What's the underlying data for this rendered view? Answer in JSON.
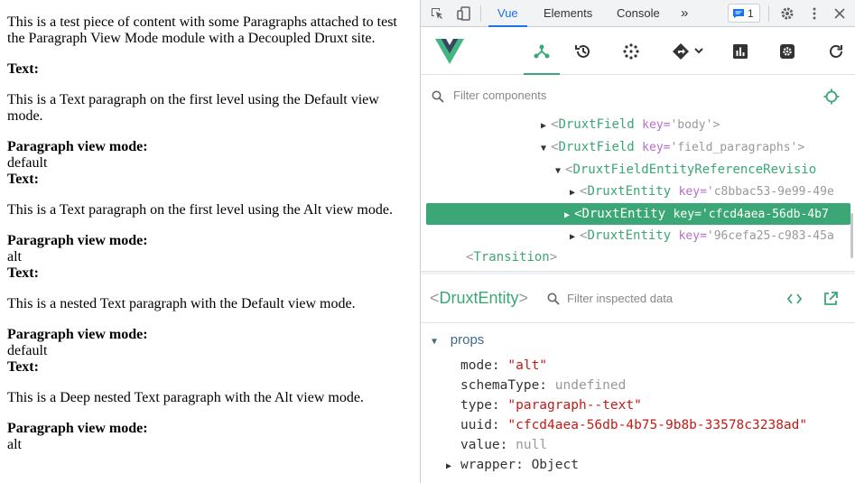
{
  "page": {
    "intro": "This is a test piece of content with some Paragraphs attached to test the Paragraph View Mode module with a Decoupled Druxt site.",
    "sections": [
      {
        "label": "Text:",
        "text": "This is a Text paragraph on the first level using the Default view mode.",
        "mode_label": "Paragraph view mode:",
        "mode": "default"
      },
      {
        "label": "Text:",
        "text": "This is a Text paragraph on the first level using the Alt view mode.",
        "mode_label": "Paragraph view mode:",
        "mode": "alt"
      },
      {
        "label": "Text:",
        "text": "This is a nested Text paragraph with the Default view mode.",
        "mode_label": "Paragraph view mode:",
        "mode": "default"
      },
      {
        "label": "Text:",
        "text": "This is a Deep nested Text paragraph with the Alt view mode.",
        "mode_label": "Paragraph view mode:",
        "mode": "alt"
      }
    ]
  },
  "devtools": {
    "tabs": [
      "Vue",
      "Elements",
      "Console"
    ],
    "more": "»",
    "issues_count": "1",
    "accent": "#1a73e8"
  },
  "vue": {
    "accent": "#3ba776",
    "toolbar_icons": [
      "components-icon",
      "timeline-icon",
      "plugins-icon",
      "router-icon",
      "performance-icon",
      "settings-icon",
      "refresh-icon"
    ],
    "filter_placeholder": "Filter components",
    "tree": [
      {
        "tag": "DruxtField",
        "key_attr": "key=",
        "key_val": "'body'>"
      },
      {
        "tag": "DruxtField",
        "key_attr": "key=",
        "key_val": "'field_paragraphs'>"
      },
      {
        "tag": "DruxtFieldEntityReferenceRevisio",
        "key_attr": "",
        "key_val": ""
      },
      {
        "tag": "DruxtEntity",
        "key_attr": "key=",
        "key_val": "'c8bbac53-9e99-49e"
      },
      {
        "tag": "DruxtEntity",
        "key_attr": "key=",
        "key_val": "'cfcd4aea-56db-4b7"
      },
      {
        "tag": "DruxtEntity",
        "key_attr": "key=",
        "key_val": "'96cefa25-c983-45a"
      },
      {
        "tag": "Transition",
        "key_attr": "",
        "key_val": ""
      }
    ],
    "inspector": {
      "title": "DruxtEntity",
      "filter_placeholder": "Filter inspected data",
      "section": "props",
      "props": [
        {
          "key": "mode:",
          "value": "\"alt\"",
          "kind": "str"
        },
        {
          "key": "schemaType:",
          "value": "undefined",
          "kind": "null"
        },
        {
          "key": "type:",
          "value": "\"paragraph--text\"",
          "kind": "str"
        },
        {
          "key": "uuid:",
          "value": "\"cfcd4aea-56db-4b75-9b8b-33578c3238ad\"",
          "kind": "str"
        },
        {
          "key": "value:",
          "value": "null",
          "kind": "null"
        },
        {
          "key": "wrapper:",
          "value": "Object",
          "kind": "obj"
        }
      ]
    }
  }
}
